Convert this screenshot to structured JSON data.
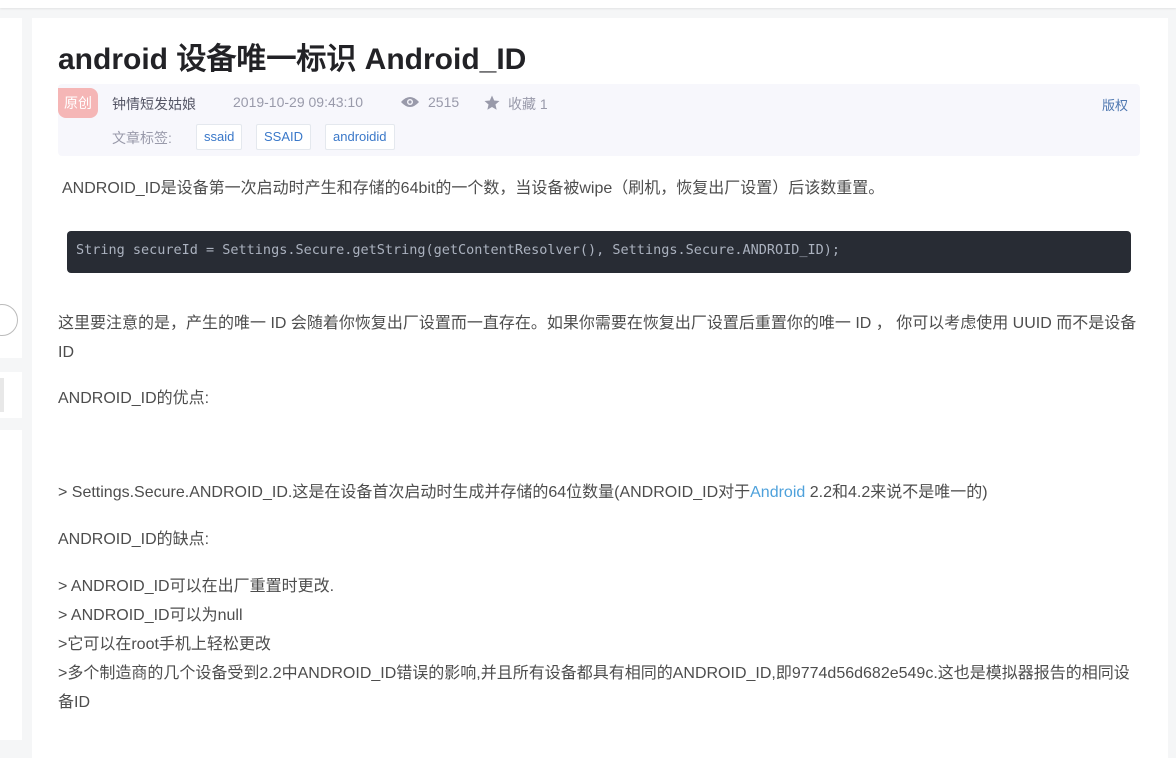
{
  "article": {
    "title": "android 设备唯一标识 Android_ID",
    "badge": "原创",
    "author": "钟情短发姑娘",
    "datetime": "2019-10-29 09:43:10",
    "views": "2515",
    "favorites": "收藏 1",
    "copyright": "版权",
    "tags_label": "文章标签:",
    "tags": [
      "ssaid",
      "SSAID",
      "androidid"
    ],
    "paragraph1": "ANDROID_ID是设备第一次启动时产生和存储的64bit的一个数，当设备被wipe（刷机，恢复出厂设置）后该数重置。",
    "code": "String secureId = Settings.Secure.getString(getContentResolver(), Settings.Secure.ANDROID_ID);",
    "paragraph2": "这里要注意的是，产生的唯一 ID 会随着你恢复出厂设置而一直存在。如果你需要在恢复出厂设置后重置你的唯一 ID ，  你可以考虑使用 UUID 而不是设备 ID",
    "advantages_heading": "ANDROID_ID的优点:",
    "advantage_prefix": "> Settings.Secure.ANDROID_ID.这是在设备首次启动时生成并存储的64位数量(ANDROID_ID对于",
    "advantage_link": "Android",
    "advantage_suffix": " 2.2和4.2来说不是唯一的)",
    "disadvantages_heading": "ANDROID_ID的缺点:",
    "disadvantages": [
      "> ANDROID_ID可以在出厂重置时更改.",
      "> ANDROID_ID可以为null",
      ">它可以在root手机上轻松更改",
      ">多个制造商的几个设备受到2.2中ANDROID_ID错误的影响,并且所有设备都具有相同的ANDROID_ID,即9774d56d682e549c.这也是模拟器报告的相同设备ID"
    ]
  },
  "colors": {
    "title": "#222226",
    "body_text": "#4d4d4d",
    "meta_text": "#999aaa",
    "link": "#4ea1db",
    "badge_bg": "#f5b6b6",
    "code_bg": "#282c34"
  }
}
